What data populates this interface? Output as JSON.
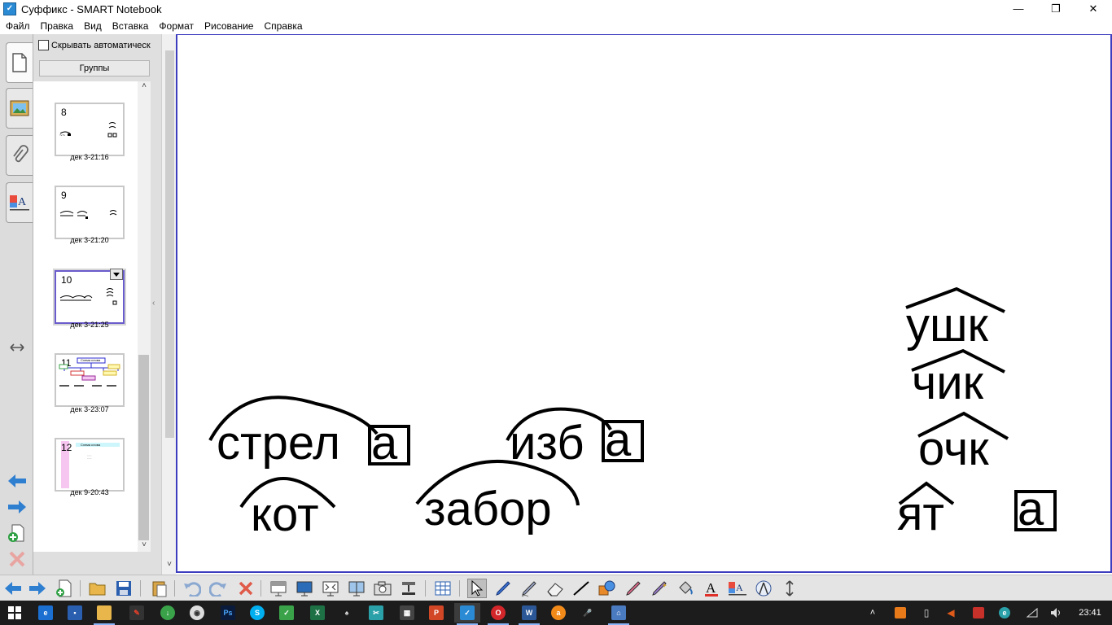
{
  "window": {
    "title": "Суффикс - SMART Notebook",
    "app_icon": "smart-notebook-icon",
    "controls": {
      "minimize": "—",
      "maximize": "❐",
      "close": "✕"
    }
  },
  "menu": [
    "Файл",
    "Правка",
    "Вид",
    "Вставка",
    "Формат",
    "Рисование",
    "Справка"
  ],
  "sorter": {
    "autohide_label": "Скрывать автоматическ",
    "autohide_checked": false,
    "groups_label": "Группы",
    "pages": [
      {
        "number": "8",
        "time": "дек 3-21:16",
        "selected": false
      },
      {
        "number": "9",
        "time": "дек 3-21:20",
        "selected": false
      },
      {
        "number": "10",
        "time": "дек 3-21:25",
        "selected": true
      },
      {
        "number": "11",
        "time": "дек 3-23:07",
        "selected": false
      },
      {
        "number": "12",
        "time": "дек 9-20:43",
        "selected": false
      }
    ],
    "thumb11_heading": "Схема слова",
    "thumb12_heading": "Схема слова"
  },
  "rail": {
    "tabs": [
      "page-sorter-icon",
      "gallery-icon",
      "attachments-icon",
      "properties-icon"
    ],
    "buttons": [
      "move-panel-icon",
      "previous-page-icon",
      "next-page-icon",
      "add-page-icon",
      "delete-page-icon"
    ]
  },
  "canvas": {
    "words": {
      "strela": "стрел",
      "strela_end": "а",
      "izba": "изб",
      "izba_end": "а",
      "kot": "кот",
      "zabor": "забор",
      "ushk": "ушк",
      "chik": "чик",
      "ochk": "очк",
      "yat": "ят",
      "ending_a": "а"
    },
    "accent_color": "#3d3dbf"
  },
  "toolbar": {
    "tools": [
      "previous-page",
      "next-page",
      "add-page",
      "open-file",
      "save-file",
      "paste",
      "undo",
      "redo",
      "delete",
      "screen-shade",
      "show-hide-tools",
      "full-screen",
      "dual-page",
      "screen-capture",
      "document-camera",
      "insert-table",
      "select",
      "pen",
      "creative-pen",
      "eraser",
      "line",
      "shapes",
      "magic-pen",
      "fill",
      "text",
      "properties",
      "measurement-tools",
      "move-toolbar"
    ]
  },
  "taskbar": {
    "apps": [
      "start",
      "edge",
      "save",
      "file-explorer",
      "media",
      "downloader",
      "game",
      "photoshop",
      "skype",
      "greenshot",
      "excel",
      "inkscape",
      "snip",
      "calculator",
      "powerpoint",
      "smart-notebook",
      "opera",
      "word",
      "avast",
      "microphone",
      "updater"
    ],
    "tray": [
      "chevron-up",
      "smart-tray",
      "usb",
      "volume-muted",
      "antivirus",
      "internet-explorer",
      "wifi",
      "volume",
      "notifications"
    ],
    "time": "23:41"
  }
}
